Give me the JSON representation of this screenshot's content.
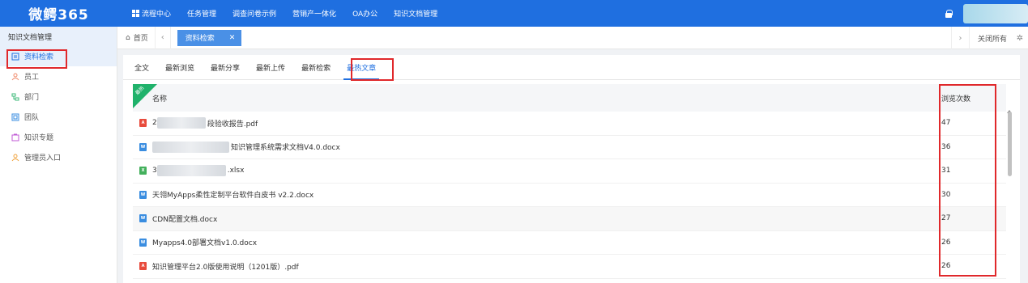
{
  "app": {
    "logo": "微鳄365"
  },
  "topnav": [
    {
      "label": "流程中心"
    },
    {
      "label": "任务管理"
    },
    {
      "label": "调查问卷示例"
    },
    {
      "label": "营销产一体化"
    },
    {
      "label": "OA办公"
    },
    {
      "label": "知识文档管理"
    }
  ],
  "sidebar": {
    "title": "知识文档管理",
    "items": [
      {
        "label": "资料检索",
        "icon": "doc-search-icon",
        "color": "#1f6fe0",
        "active": true
      },
      {
        "label": "员工",
        "icon": "person-icon",
        "color": "#f08a6b"
      },
      {
        "label": "部门",
        "icon": "org-icon",
        "color": "#3cb878"
      },
      {
        "label": "团队",
        "icon": "team-icon",
        "color": "#3a8de0"
      },
      {
        "label": "知识专题",
        "icon": "topic-icon",
        "color": "#c05ad6"
      },
      {
        "label": "管理员入口",
        "icon": "admin-icon",
        "color": "#f0a23c"
      }
    ]
  },
  "tabsbar": {
    "home": "首页",
    "active_tab": "资料检索",
    "close_all": "关闭所有"
  },
  "subtabs": [
    {
      "label": "全文"
    },
    {
      "label": "最新浏览"
    },
    {
      "label": "最新分享"
    },
    {
      "label": "最新上传"
    },
    {
      "label": "最新检索"
    },
    {
      "label": "最热文章",
      "active": true
    }
  ],
  "table": {
    "ribbon": "最热",
    "col_name": "名称",
    "col_views": "浏览次数",
    "rows": [
      {
        "type": "pdf",
        "prefix": "2",
        "name": "段验收报告.pdf",
        "views": "47",
        "blur": 60
      },
      {
        "type": "docx",
        "prefix": "",
        "name": "知识管理系统需求文档V4.0.docx",
        "views": "36",
        "blur": 95
      },
      {
        "type": "xlsx",
        "prefix": "3",
        "name": ".xlsx",
        "views": "31",
        "blur": 85
      },
      {
        "type": "docx",
        "prefix": "",
        "name": "天翎MyApps柔性定制平台软件白皮书 v2.2.docx",
        "views": "30",
        "blur": 0
      },
      {
        "type": "docx",
        "prefix": "",
        "name": "CDN配置文档.docx",
        "views": "27",
        "blur": 0
      },
      {
        "type": "docx",
        "prefix": "",
        "name": "Myapps4.0部署文档v1.0.docx",
        "views": "26",
        "blur": 0
      },
      {
        "type": "pdf",
        "prefix": "",
        "name": "知识管理平台2.0版使用说明（1201版）.pdf",
        "views": "26",
        "blur": 0
      }
    ]
  },
  "colors": {
    "primary": "#1f6fe0",
    "highlight_box": "#e0282b",
    "ribbon": "#20b26b"
  }
}
